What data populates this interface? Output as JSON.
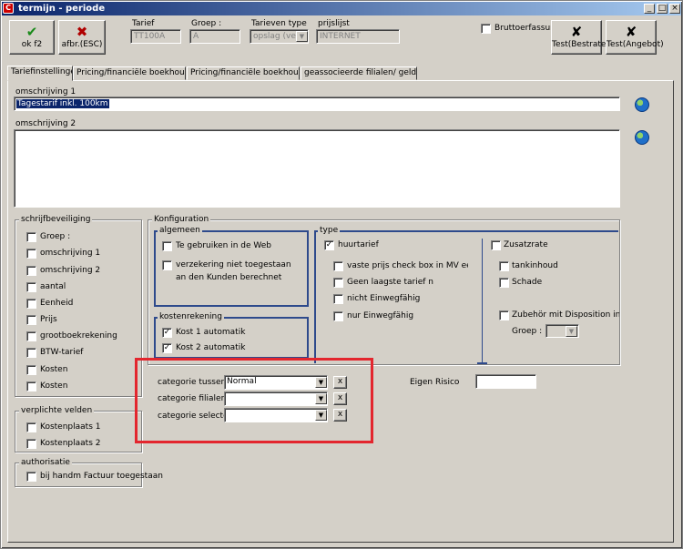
{
  "window": {
    "title": "termijn - periode",
    "app_icon": "C",
    "controls": [
      "_",
      "□",
      "×"
    ]
  },
  "toolbar": {
    "ok_label": "ok f2",
    "cancel_label": "afbr.(ESC)",
    "ok_icon": "✔",
    "cancel_icon": "✖",
    "tarief_label": "Tarief",
    "tarief_value": "TT100A",
    "groep_label": "Groep :",
    "groep_value": "A",
    "tarieven_type_label": "Tarieven type",
    "tarieven_type_value": "opslag (verkc",
    "prijslijst_label": "prijslijst",
    "prijslijst_value": "INTERNET",
    "bruttoerfassung_label": "Bruttoerfassung",
    "test_bestrate_label": "Test(Bestrate)",
    "test_angebot_label": "Test(Angebot)",
    "tool_icon": "✘"
  },
  "tabs": [
    "Tariefinstellingen",
    "Pricing/financiële boekhouding I",
    "Pricing/financiële boekhouding II",
    "geassocieerde filialen/ geldigheid"
  ],
  "omschrijving1": {
    "label": "omschrijving 1",
    "value": "Tagestarif inkl. 100km"
  },
  "omschrijving2": {
    "label": "omschrijving 2",
    "value": ""
  },
  "schrijfbeveiliging": {
    "title": "schrijfbeveiliging",
    "items": [
      "Groep :",
      "omschrijving 1",
      "omschrijving 2",
      "aantal",
      "Eenheid",
      "Prijs",
      "grootboekrekening",
      "BTW-tarief",
      "Kosten",
      "Kosten"
    ]
  },
  "verplichte_velden": {
    "title": "verplichte velden",
    "items": [
      "Kostenplaats 1",
      "Kostenplaats 2"
    ]
  },
  "authorisatie": {
    "title": "authorisatie",
    "items": [
      "bij handm  Factuur toegestaan"
    ]
  },
  "konfiguration": {
    "title": "Konfiguration",
    "algemeen": {
      "title": "algemeen",
      "item1": "Te gebruiken in de Web",
      "item2_line1": "verzekering niet toegestaan",
      "item2_line2": "an den Kunden berechnet"
    },
    "kostenrekening": {
      "title": "kostenrekening",
      "item1": "Kost 1 automatik",
      "item2": "Kost 2 automatik"
    },
    "type": {
      "title": "type",
      "huurtarief": "huurtarief",
      "vaste_prijs": "vaste prijs check box in MV eerst selc",
      "geen_laagste": "Geen laagste  tarief n",
      "nicht_einwegfahig": "nicht Einwegfähig",
      "nur_einwegfahig": "nur Einwegfähig",
      "zusatzrate": "Zusatzrate",
      "tankinhoud": "tankinhoud",
      "schade": "Schade",
      "zubehor": "Zubehör mit Disposition in Gruppe",
      "groep_label": "Groep :"
    }
  },
  "categorie": {
    "tussenpers_label": "categorie tussenpers",
    "tussenpers_value": "Normal",
    "filialen_label": "categorie filialen",
    "filialen_value": "",
    "selecteren_label": "categorie selecteren",
    "selecteren_value": "",
    "clear_label": "x",
    "arrow": "▼"
  },
  "eigen_risico": {
    "label": "Eigen Risico",
    "value": ""
  },
  "colors": {
    "face": "#d4d0c8",
    "titlebar": "#0a246a",
    "highlight": "#e3262e",
    "selection": "#0a246a"
  }
}
